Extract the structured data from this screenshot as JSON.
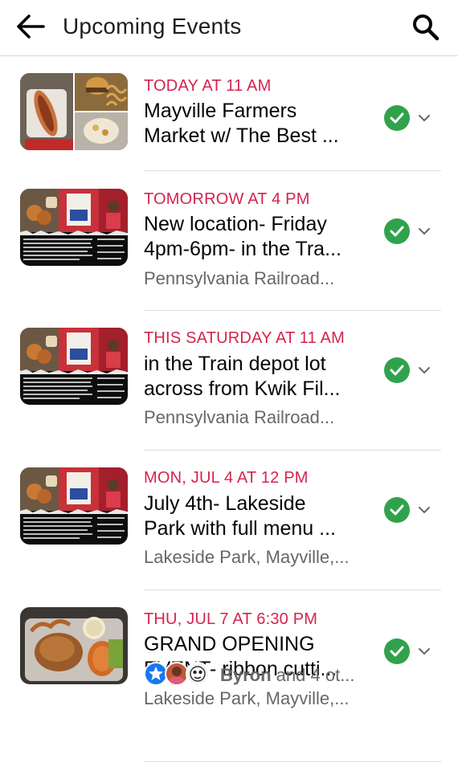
{
  "header": {
    "title": "Upcoming Events",
    "back_icon": "arrow-left-icon",
    "search_icon": "search-icon"
  },
  "events": [
    {
      "date": "TODAY AT 11 AM",
      "name_line1": "Mayville Farmers",
      "name_line2": "Market w/ The Best ...",
      "location": ""
    },
    {
      "date": "TOMORROW AT 4 PM",
      "name_line1": "New location- Friday",
      "name_line2": "4pm-6pm- in the Tra...",
      "location": "Pennsylvania Railroad..."
    },
    {
      "date": "THIS SATURDAY AT 11 AM",
      "name_line1": "in the Train depot lot",
      "name_line2": "across from Kwik Fil...",
      "location": "Pennsylvania Railroad..."
    },
    {
      "date": "MON, JUL 4 AT 12 PM",
      "name_line1": "July 4th- Lakeside",
      "name_line2": "Park with full menu ...",
      "location": "Lakeside Park, Mayville,..."
    },
    {
      "date": "THU, JUL 7 AT 6:30 PM",
      "name_line1": "GRAND OPENING",
      "name_line2": "EVENT- ribbon cutti...",
      "location": "Lakeside Park, Mayville,..."
    }
  ],
  "friends": {
    "name": "Byron",
    "rest": " and 4 ot..."
  },
  "colors": {
    "date_red": "#d5244d",
    "going_green": "#31a24c",
    "secondary_text": "#65676b"
  }
}
